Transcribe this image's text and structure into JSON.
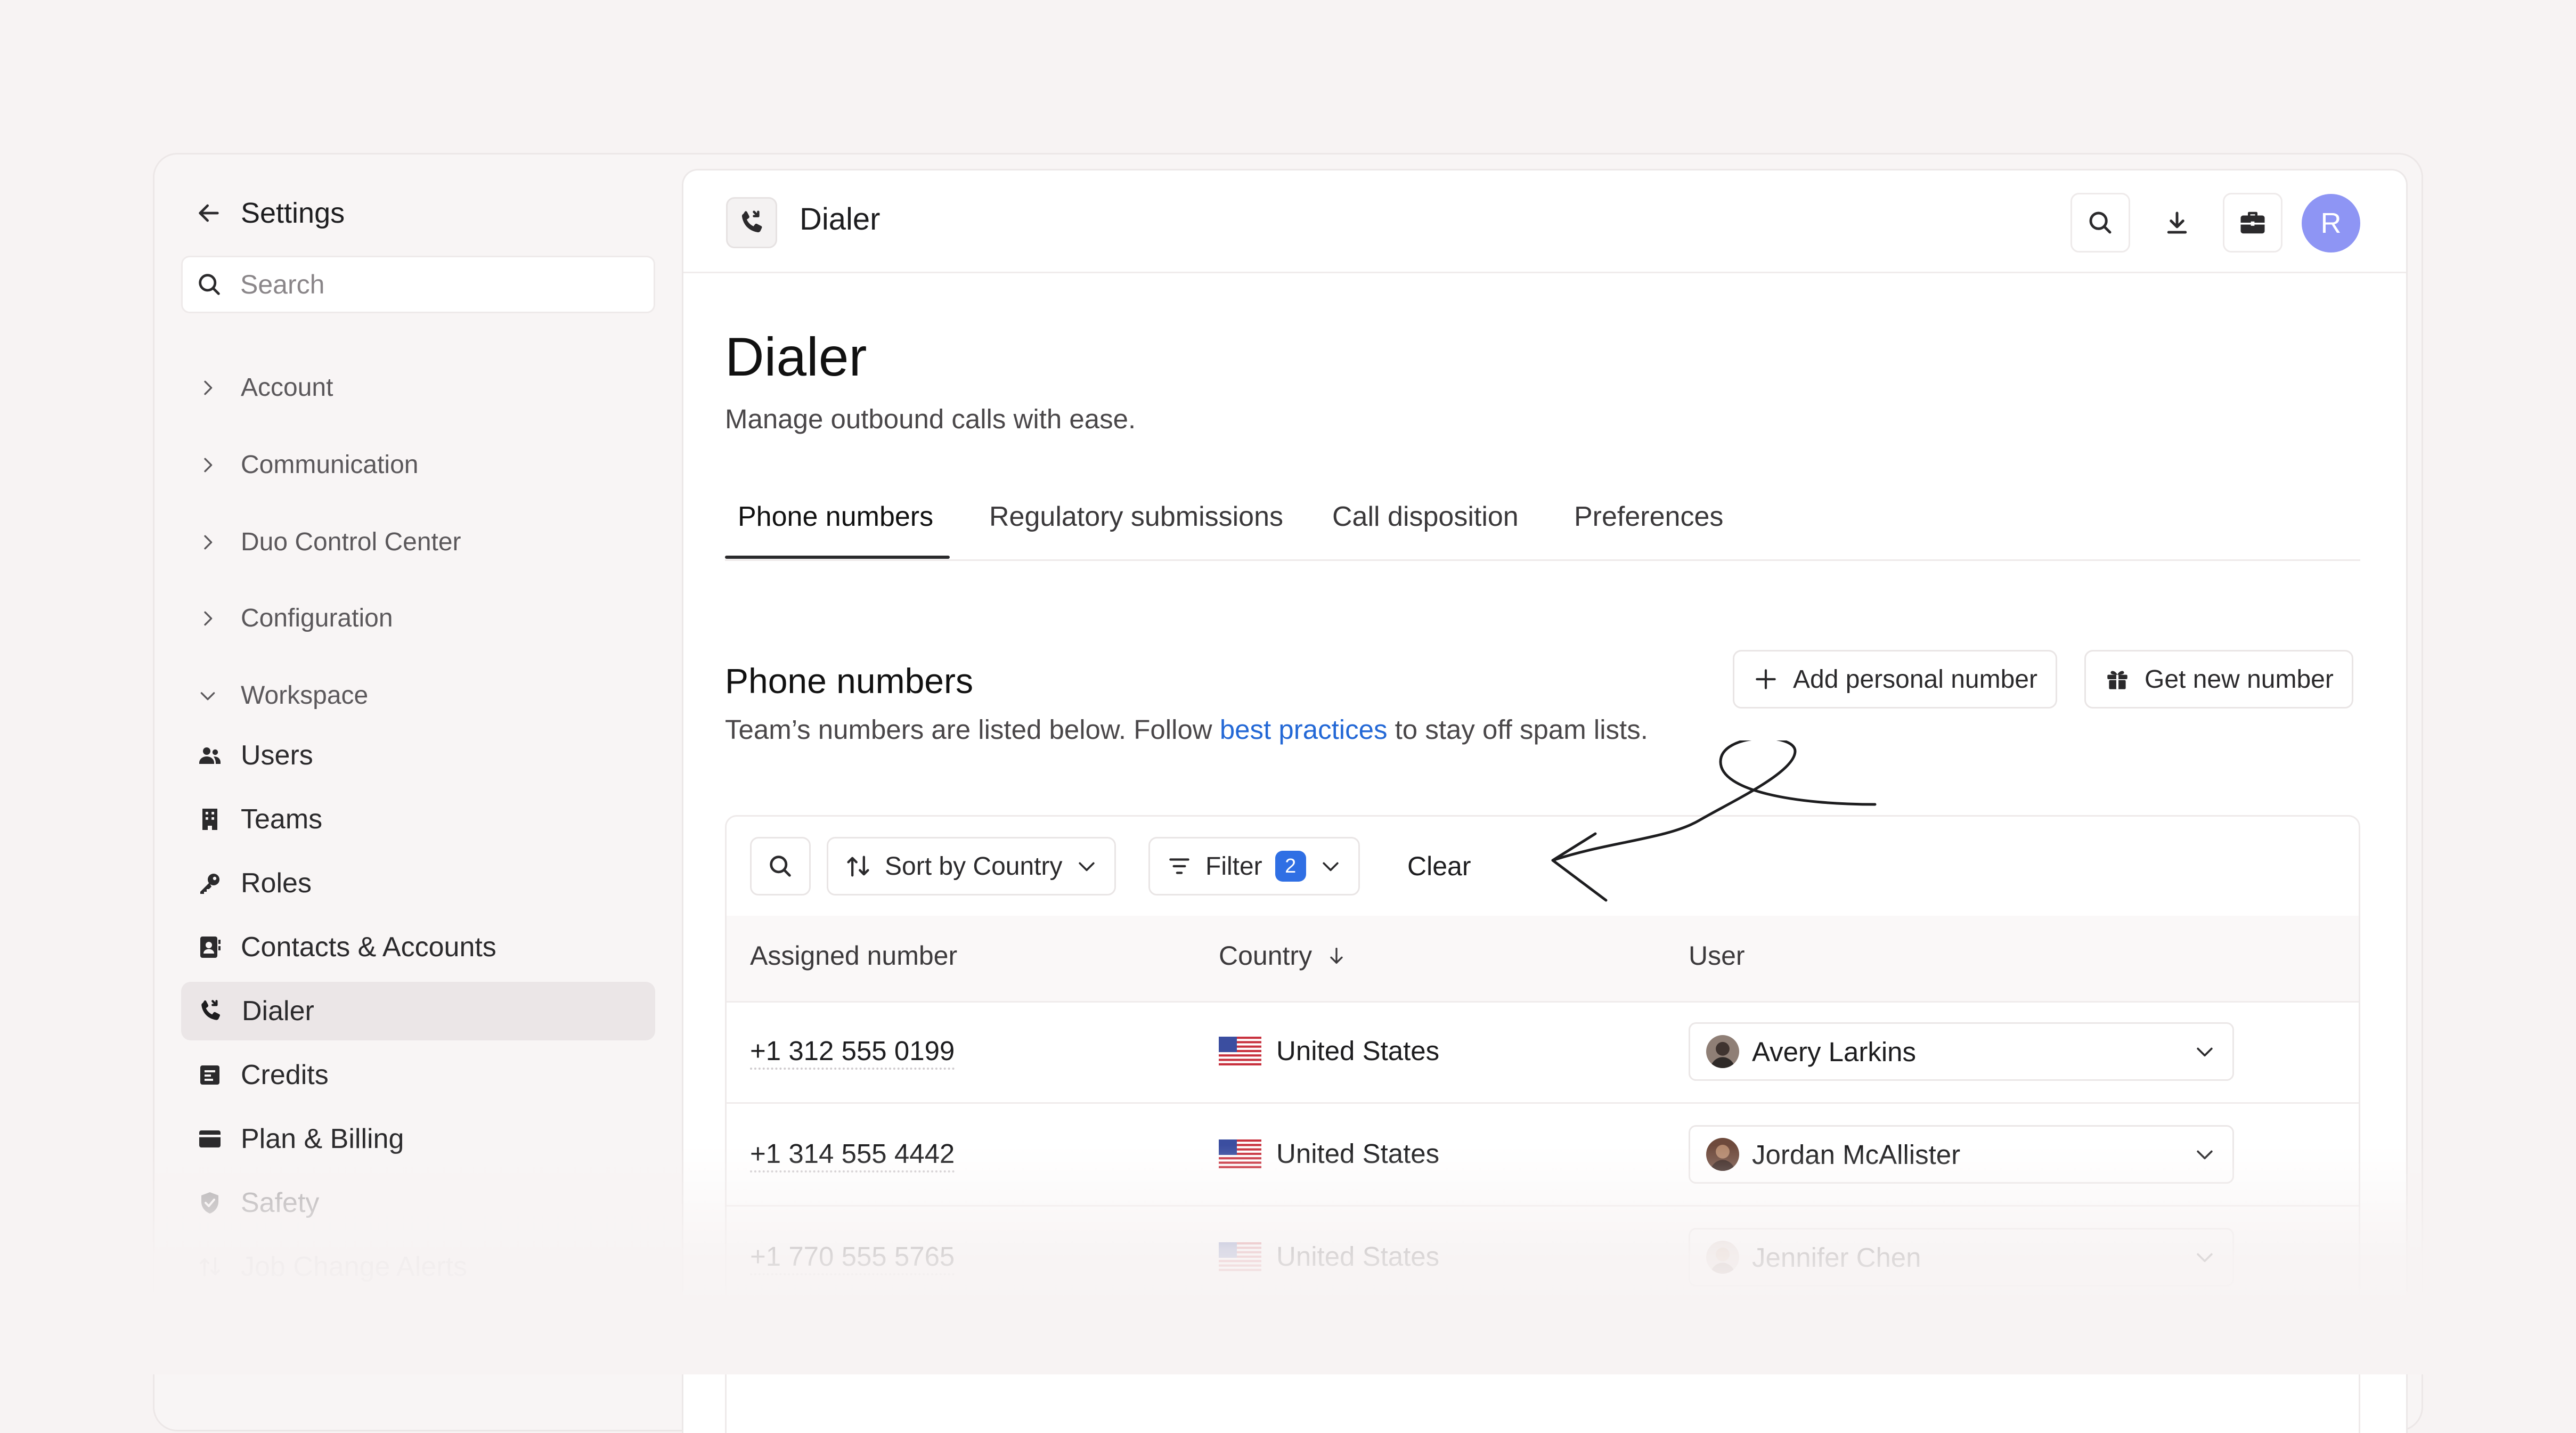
{
  "sidebar": {
    "back_title": "Settings",
    "search_placeholder": "Search",
    "groups": [
      {
        "label": "Account"
      },
      {
        "label": "Communication"
      },
      {
        "label": "Duo Control Center"
      },
      {
        "label": "Configuration"
      }
    ],
    "workspace_label": "Workspace",
    "items": [
      {
        "label": "Users",
        "icon": "users-icon"
      },
      {
        "label": "Teams",
        "icon": "building-icon"
      },
      {
        "label": "Roles",
        "icon": "key-icon"
      },
      {
        "label": "Contacts & Accounts",
        "icon": "contact-card-icon"
      },
      {
        "label": "Dialer",
        "icon": "phone-call-icon",
        "active": true
      },
      {
        "label": "Credits",
        "icon": "receipt-icon"
      },
      {
        "label": "Plan & Billing",
        "icon": "wallet-icon"
      },
      {
        "label": "Safety",
        "icon": "shield-check-icon"
      },
      {
        "label": "Job Change Alerts",
        "icon": "arrows-swap-icon"
      }
    ]
  },
  "topbar": {
    "title": "Dialer",
    "avatar_initial": "R"
  },
  "page": {
    "title": "Dialer",
    "subtitle": "Manage outbound calls with ease."
  },
  "tabs": [
    {
      "label": "Phone numbers",
      "active": true
    },
    {
      "label": "Regulatory submissions"
    },
    {
      "label": "Call disposition"
    },
    {
      "label": "Preferences"
    }
  ],
  "section": {
    "title": "Phone numbers",
    "desc_before": "Team’s numbers are listed below. Follow ",
    "desc_link": "best practices",
    "desc_after": " to stay off spam lists.",
    "add_personal_label": "Add personal number",
    "get_new_label": "Get new number"
  },
  "toolbar": {
    "sort_label": "Sort by Country",
    "filter_label": "Filter",
    "filter_count": "2",
    "clear_label": "Clear"
  },
  "table": {
    "columns": [
      "Assigned number",
      "Country",
      "User"
    ],
    "rows": [
      {
        "number": "+1 312 555 0199",
        "country": "United States",
        "user": "Avery Larkins"
      },
      {
        "number": "+1 314 555 4442",
        "country": "United States",
        "user": "Jordan McAllister"
      },
      {
        "number": "+1 770 555 5765",
        "country": "United States",
        "user": "Jennifer Chen"
      }
    ]
  },
  "colors": {
    "accent": "#2368d6",
    "badge": "#2f6fe4",
    "avatar": "#8e95f4",
    "active_nav": "#ebe6e7"
  }
}
